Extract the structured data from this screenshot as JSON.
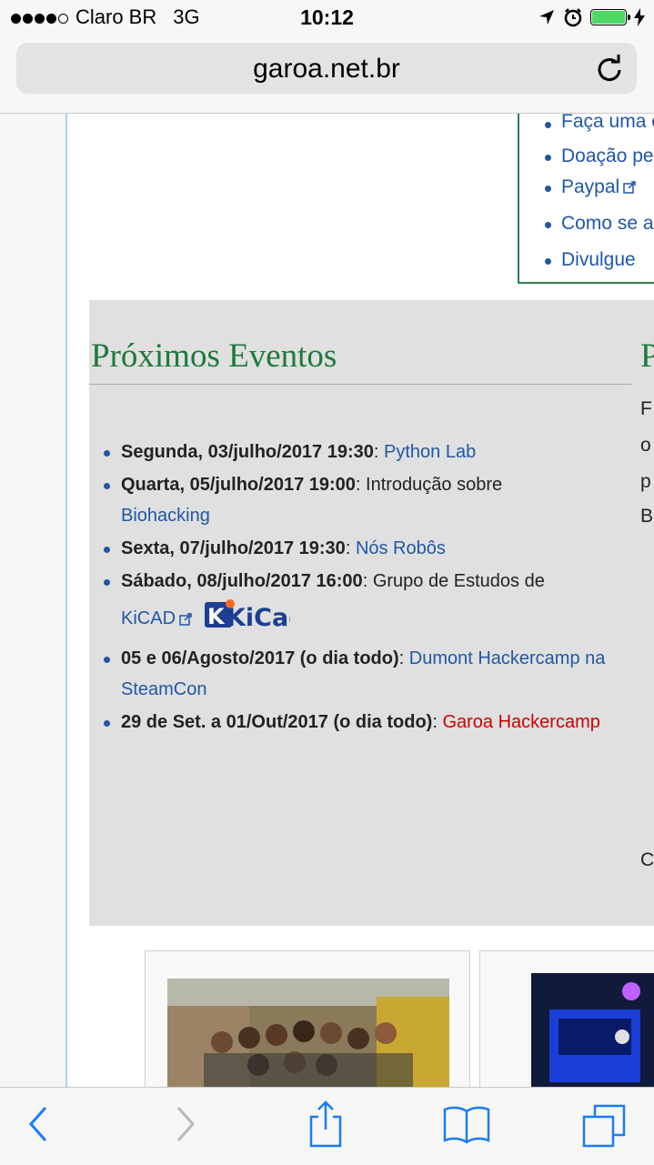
{
  "status_bar": {
    "carrier": "Claro BR",
    "network": "3G",
    "time": "10:12",
    "battery_level": 1.0,
    "colors": {
      "battery": "#4cd964"
    }
  },
  "browser": {
    "url": "garoa.net.br"
  },
  "donate_box": {
    "items": [
      {
        "label": "Faça uma c"
      },
      {
        "label": "Doação pe"
      },
      {
        "label": "Paypal"
      },
      {
        "label": "Como se a"
      },
      {
        "label": "Divulgue"
      }
    ]
  },
  "events": {
    "title": "Próximos Eventos",
    "items": [
      {
        "date": "Segunda, 03/julho/2017 19:30",
        "sep": ": ",
        "text": "",
        "link": "Python Lab"
      },
      {
        "date": "Quarta, 05/julho/2017 19:00",
        "sep": ": ",
        "text": "Introdução sobre",
        "link": "Biohacking"
      },
      {
        "date": "Sexta, 07/julho/2017 19:30",
        "sep": ": ",
        "text": "",
        "link": "Nós Robôs"
      },
      {
        "date": "Sábado, 08/julho/2017 16:00",
        "sep": ": ",
        "text": "Grupo de Estudos de",
        "link": "KiCAD",
        "logo": "KiCad"
      },
      {
        "date": "05 e 06/Agosto/2017 (o dia todo)",
        "sep": ": ",
        "text": "",
        "link": "Dumont Hackercamp na SteamCon"
      },
      {
        "date": "29 de Set. a 01/Out/2017 (o dia todo)",
        "sep": ": ",
        "text": "",
        "link": "Garoa Hackercamp"
      }
    ]
  },
  "right_column": {
    "title": "P",
    "letters": [
      "F",
      "o",
      "p",
      "B",
      "C"
    ]
  },
  "colors": {
    "link": "#1f57a8",
    "redlink": "#cc0000",
    "heading": "#1e7a3c"
  }
}
